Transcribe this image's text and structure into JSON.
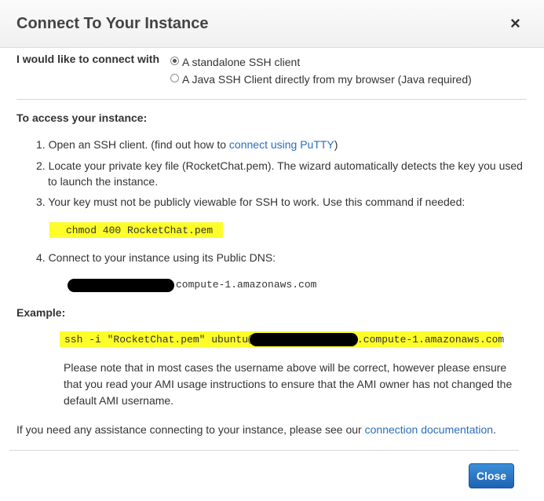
{
  "dialog": {
    "title": "Connect To Your Instance",
    "close_icon": "×"
  },
  "connect_with": {
    "label": "I would like to connect with",
    "options": [
      {
        "label": "A standalone SSH client",
        "checked": true
      },
      {
        "label": "A Java SSH Client directly from my browser (Java required)",
        "checked": false
      }
    ]
  },
  "access": {
    "heading": "To access your instance:",
    "step1_prefix": "1.  Open an SSH client. (find out how to ",
    "step1_link": "connect using PuTTY",
    "step1_suffix": ")",
    "step2_line1": "2.  Locate your private key file (RocketChat.pem). The wizard automatically detects the key you used",
    "step2_line2": "to launch the instance.",
    "step3": "3.  Your key must not be publicly viewable for SSH to work. Use this command if needed:",
    "chmod_command": "chmod 400 RocketChat.pem",
    "step4": "4.  Connect to your instance using its Public DNS:",
    "dns_suffix": "compute-1.amazonaws.com"
  },
  "example": {
    "heading": "Example:",
    "command_prefix": "ssh -i \"RocketChat.pem\" ubuntu@",
    "command_suffix": ".compute-1.amazonaws.com",
    "note_line1": "Please note that in most cases the username above will be correct, however please ensure",
    "note_line2": "that you read your AMI usage instructions to ensure that the AMI owner has not changed the",
    "note_line3": "default AMI username."
  },
  "assistance": {
    "prefix": "If you need any assistance connecting to your instance, please see our ",
    "link": "connection documentation",
    "suffix": "."
  },
  "footer": {
    "close_label": "Close"
  },
  "colors": {
    "highlight": "#fdfd2a",
    "link": "#2a6ebb",
    "button": "#1c63b3"
  }
}
